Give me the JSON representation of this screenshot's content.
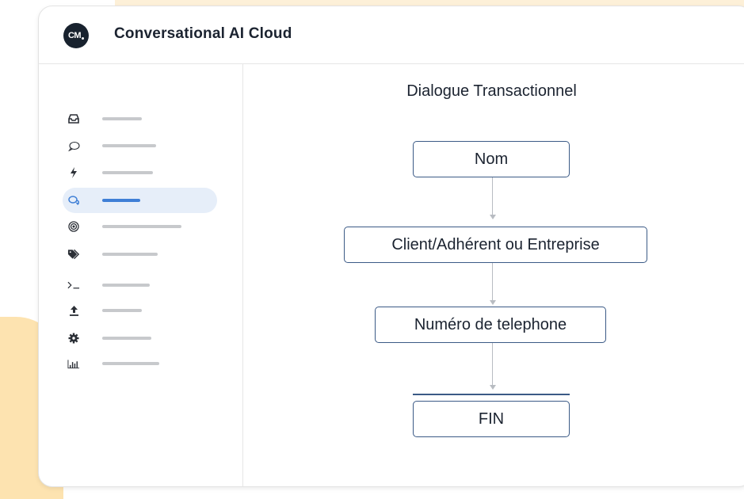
{
  "app": {
    "title": "Conversational AI Cloud",
    "logo_text": "CM"
  },
  "sidebar": {
    "items": [
      {
        "icon": "inbox-icon",
        "glyph": "",
        "active": false,
        "bar": 50
      },
      {
        "icon": "speech-bubble-icon",
        "glyph": "",
        "active": false,
        "bar": 68
      },
      {
        "icon": "lightning-icon",
        "glyph": "",
        "active": false,
        "bar": 64
      },
      {
        "icon": "conversation-icon",
        "glyph": "",
        "active": true,
        "bar": 48
      },
      {
        "icon": "target-icon",
        "glyph": "",
        "active": false,
        "bar": 100
      },
      {
        "icon": "tags-icon",
        "glyph": "",
        "active": false,
        "bar": 70
      },
      {
        "icon": "terminal-icon",
        "glyph": "",
        "active": false,
        "bar": 60
      },
      {
        "icon": "upload-icon",
        "glyph": "",
        "active": false,
        "bar": 50
      },
      {
        "icon": "gear-icon",
        "glyph": "",
        "active": false,
        "bar": 62
      },
      {
        "icon": "bar-chart-icon",
        "glyph": "",
        "active": false,
        "bar": 72
      }
    ]
  },
  "flow": {
    "title": "Dialogue Transactionnel",
    "nodes": [
      "Nom",
      "Client/Adhérent ou Entreprise",
      "Numéro de telephone",
      "FIN"
    ]
  },
  "colors": {
    "accent": "#3f7fd6",
    "node_border": "#3b5a86",
    "connector": "#b8bcc2",
    "highlight_top": "#fdf0d8",
    "highlight_left": "#fde3b0"
  }
}
